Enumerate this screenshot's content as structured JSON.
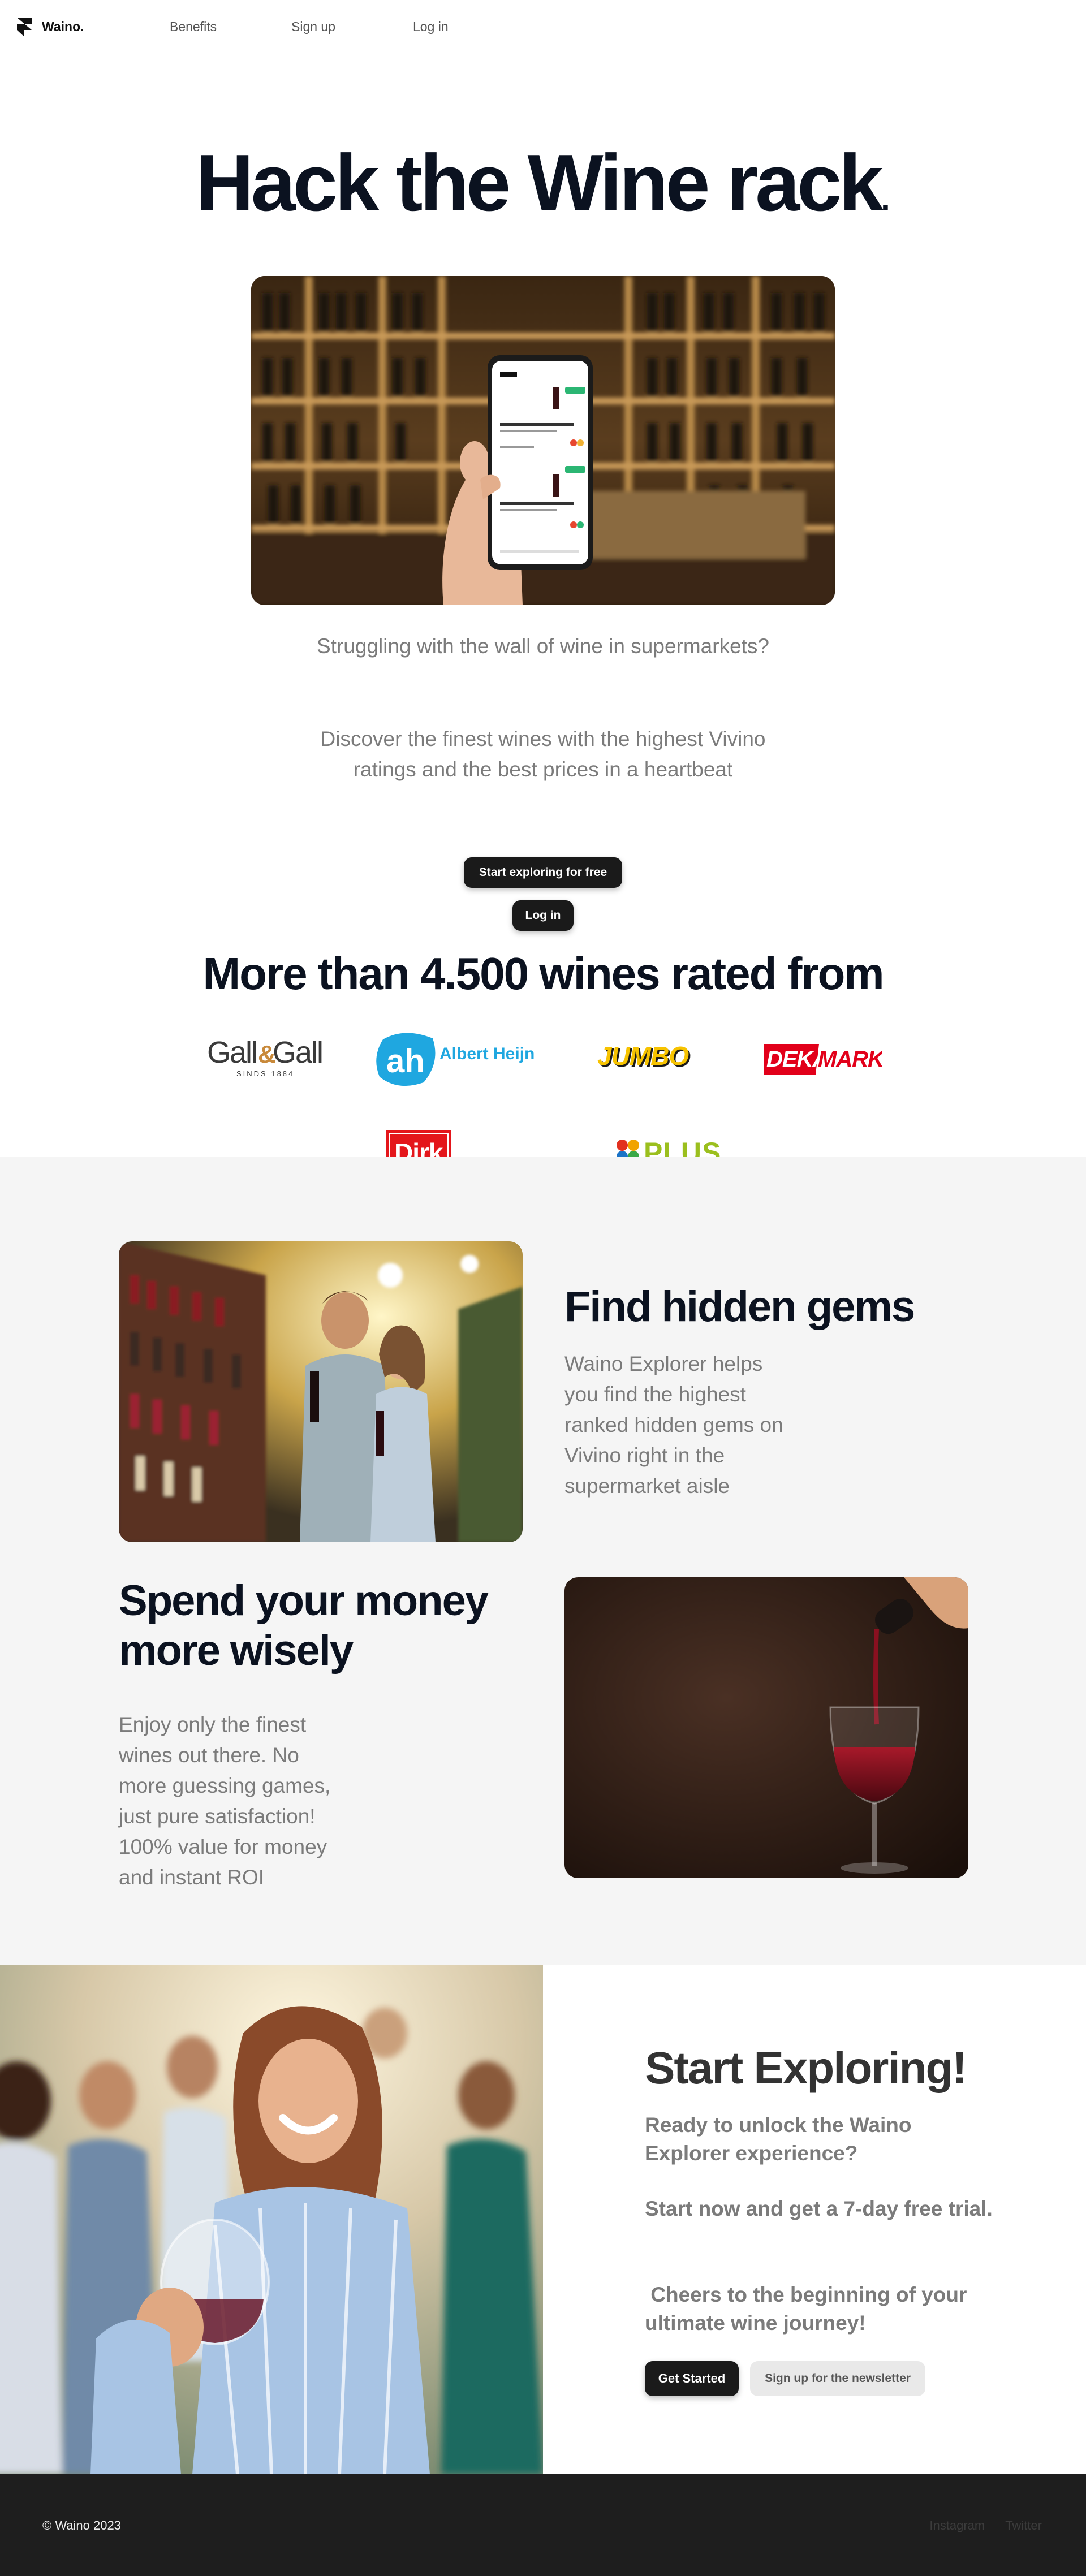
{
  "nav": {
    "brand": "Waino.",
    "links": [
      "Benefits",
      "Sign up",
      "Log in"
    ]
  },
  "hero": {
    "title": "Hack the Wine rack",
    "title_dot": ".",
    "text1": "Struggling with the wall of wine in supermarkets?",
    "text2": "Discover the finest wines with the highest Vivino ratings and the best prices in a heartbeat",
    "explore_button": "Start exploring for free",
    "login_button": "Log in"
  },
  "wines": {
    "heading": "More than 4.500 wines rated from",
    "logos": {
      "gall_main": "Gall",
      "gall_amp": "&",
      "gall_second": "Gall",
      "gall_sub": "SINDS 1884",
      "ah_mark": "ah",
      "ah_name": "Albert Heijn",
      "jumbo": "JUMBO",
      "deka": "DEKA",
      "markt": "MARKT",
      "dirk": "Dirk",
      "plus": "PLUS"
    }
  },
  "features": {
    "gems_title": "Find hidden gems",
    "gems_text": "Waino Explorer helps you find the highest ranked hidden gems on Vivino right in the supermarket aisle",
    "money_title": "Spend your money more wisely",
    "money_text": "Enjoy only the finest wines out there. No more guessing games, just pure satisfaction! 100% value for money and instant ROI"
  },
  "cta": {
    "title": "Start Exploring!",
    "p1": "Ready to unlock the Waino Explorer experience?",
    "p2": "Start now and get a 7-day free trial.",
    "p3": " Cheers to the beginning of your ultimate wine journey!",
    "started_button": "Get Started",
    "newsletter_button": "Sign up for the newsletter"
  },
  "footer": {
    "copyright": "© Waino 2023",
    "links": [
      "Instagram",
      "Twitter"
    ]
  },
  "colors": {
    "dark": "#0b1220",
    "muted_text": "#7b7b7b",
    "feature_bg": "#f5f5f5",
    "footer_bg": "#1e1e1e",
    "ah_blue": "#1fa7e0",
    "jumbo_yellow": "#f7c300",
    "deka_red": "#e2001a",
    "dirk_red": "#e4161b",
    "plus_green": "#9bbf1e"
  }
}
